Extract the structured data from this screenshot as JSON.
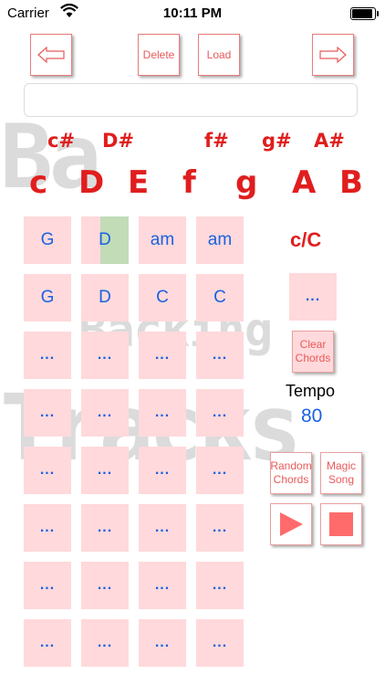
{
  "status_bar": {
    "carrier": "Carrier",
    "time": "10:11 PM"
  },
  "toolbar": {
    "back_icon": "arrow-left-icon",
    "delete_label": "Delete",
    "load_label": "Load",
    "forward_icon": "arrow-right-icon"
  },
  "song_name": {
    "value": ""
  },
  "watermark": {
    "line1": "Ba",
    "line2": "Backing",
    "line3": "Tracks"
  },
  "keys": {
    "sharps": [
      "c#",
      "D#",
      "f#",
      "g#",
      "A#"
    ],
    "naturals": [
      "c",
      "D",
      "E",
      "f",
      "g",
      "A",
      "B"
    ]
  },
  "grid": {
    "rows": [
      [
        "G",
        "D",
        "am",
        "am"
      ],
      [
        "G",
        "D",
        "C",
        "C"
      ],
      [
        "...",
        "...",
        "...",
        "..."
      ],
      [
        "...",
        "...",
        "...",
        "..."
      ],
      [
        "...",
        "...",
        "...",
        "..."
      ],
      [
        "...",
        "...",
        "...",
        "..."
      ],
      [
        "...",
        "...",
        "...",
        "..."
      ],
      [
        "...",
        "...",
        "...",
        "..."
      ]
    ]
  },
  "side": {
    "current_chord": "c/C",
    "chord_slot": "...",
    "clear_line1": "Clear",
    "clear_line2": "Chords",
    "tempo_label": "Tempo",
    "tempo_value": "80",
    "random_line1": "Random",
    "random_line2": "Chords",
    "magic_line1": "Magic",
    "magic_line2": "Song",
    "play_icon": "play-icon",
    "stop_icon": "stop-icon"
  },
  "colors": {
    "accent": "#e01e1e",
    "cell_bg": "#ffd9db",
    "chord_text": "#1a62e0",
    "highlight": "#b6dcb0"
  }
}
